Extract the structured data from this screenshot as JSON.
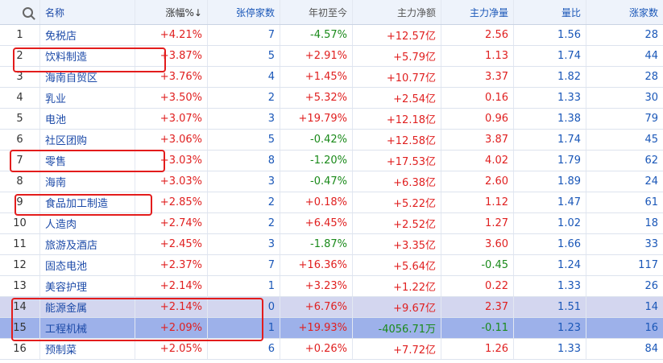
{
  "header": {
    "name": "名称",
    "chg_pct": "涨幅%↓",
    "limit_up_count": "张停家数",
    "ytd": "年初至今",
    "main_net": "主力净额",
    "main_net_qty": "主力净量",
    "vol_ratio": "量比",
    "rise_count": "涨家数"
  },
  "rows": [
    {
      "idx": "1",
      "name": "免税店",
      "chg": "+4.21%",
      "lu": "7",
      "ytd": "-4.57%",
      "net": "+12.57亿",
      "qty": "2.56",
      "vr": "1.56",
      "rc": "28"
    },
    {
      "idx": "2",
      "name": "饮料制造",
      "chg": "+3.87%",
      "lu": "5",
      "ytd": "+2.91%",
      "net": "+5.79亿",
      "qty": "1.13",
      "vr": "1.74",
      "rc": "44"
    },
    {
      "idx": "3",
      "name": "海南自贸区",
      "chg": "+3.76%",
      "lu": "4",
      "ytd": "+1.45%",
      "net": "+10.77亿",
      "qty": "3.37",
      "vr": "1.82",
      "rc": "28"
    },
    {
      "idx": "4",
      "name": "乳业",
      "chg": "+3.50%",
      "lu": "2",
      "ytd": "+5.32%",
      "net": "+2.54亿",
      "qty": "0.16",
      "vr": "1.33",
      "rc": "30"
    },
    {
      "idx": "5",
      "name": "电池",
      "chg": "+3.07%",
      "lu": "3",
      "ytd": "+19.79%",
      "net": "+12.18亿",
      "qty": "0.96",
      "vr": "1.38",
      "rc": "79"
    },
    {
      "idx": "6",
      "name": "社区团购",
      "chg": "+3.06%",
      "lu": "5",
      "ytd": "-0.42%",
      "net": "+12.58亿",
      "qty": "3.87",
      "vr": "1.74",
      "rc": "45"
    },
    {
      "idx": "7",
      "name": "零售",
      "chg": "+3.03%",
      "lu": "8",
      "ytd": "-1.20%",
      "net": "+17.53亿",
      "qty": "4.02",
      "vr": "1.79",
      "rc": "62"
    },
    {
      "idx": "8",
      "name": "海南",
      "chg": "+3.03%",
      "lu": "3",
      "ytd": "-0.47%",
      "net": "+6.38亿",
      "qty": "2.60",
      "vr": "1.89",
      "rc": "24"
    },
    {
      "idx": "9",
      "name": "食品加工制造",
      "chg": "+2.85%",
      "lu": "2",
      "ytd": "+0.18%",
      "net": "+5.22亿",
      "qty": "1.12",
      "vr": "1.47",
      "rc": "61"
    },
    {
      "idx": "10",
      "name": "人造肉",
      "chg": "+2.74%",
      "lu": "2",
      "ytd": "+6.45%",
      "net": "+2.52亿",
      "qty": "1.27",
      "vr": "1.02",
      "rc": "18"
    },
    {
      "idx": "11",
      "name": "旅游及酒店",
      "chg": "+2.45%",
      "lu": "3",
      "ytd": "-1.87%",
      "net": "+3.35亿",
      "qty": "3.60",
      "vr": "1.66",
      "rc": "33"
    },
    {
      "idx": "12",
      "name": "固态电池",
      "chg": "+2.37%",
      "lu": "7",
      "ytd": "+16.36%",
      "net": "+5.64亿",
      "qty": "-0.45",
      "vr": "1.24",
      "rc": "117"
    },
    {
      "idx": "13",
      "name": "美容护理",
      "chg": "+2.14%",
      "lu": "1",
      "ytd": "+3.23%",
      "net": "+1.22亿",
      "qty": "0.22",
      "vr": "1.33",
      "rc": "26"
    },
    {
      "idx": "14",
      "name": "能源金属",
      "chg": "+2.14%",
      "lu": "0",
      "ytd": "+6.76%",
      "net": "+9.67亿",
      "qty": "2.37",
      "vr": "1.51",
      "rc": "14"
    },
    {
      "idx": "15",
      "name": "工程机械",
      "chg": "+2.09%",
      "lu": "1",
      "ytd": "+19.93%",
      "net": "-4056.71万",
      "qty": "-0.11",
      "vr": "1.23",
      "rc": "16"
    },
    {
      "idx": "16",
      "name": "预制菜",
      "chg": "+2.05%",
      "lu": "6",
      "ytd": "+0.26%",
      "net": "+7.72亿",
      "qty": "1.26",
      "vr": "1.33",
      "rc": "84"
    }
  ],
  "colors": {
    "up": "#e02020",
    "down": "#1a8a1a",
    "highlight_selected": "#9db1ea",
    "highlight_row": "#d3d6ef",
    "annotation": "#e31c1c"
  }
}
